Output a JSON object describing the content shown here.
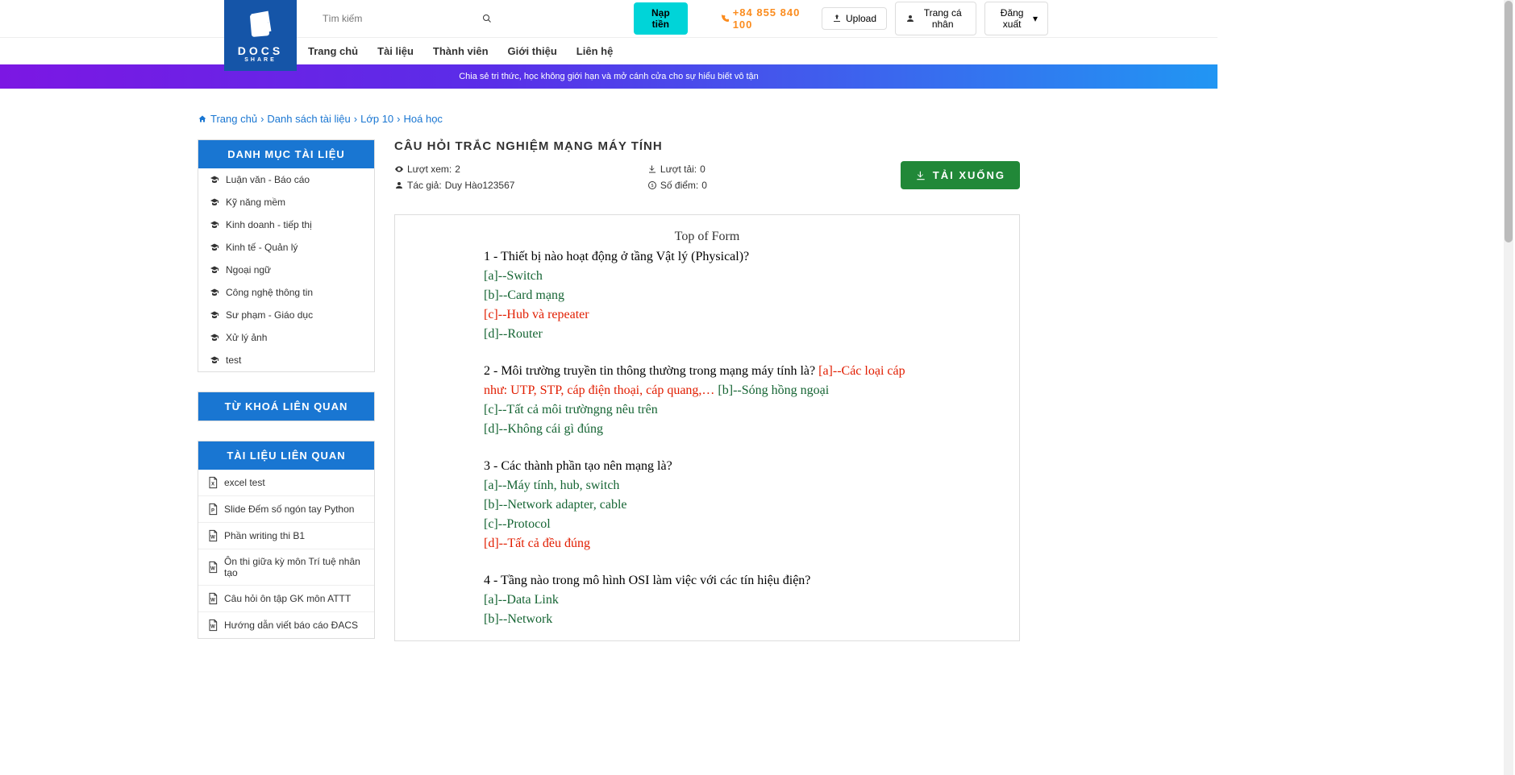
{
  "header": {
    "search_placeholder": "Tìm kiếm",
    "btn_nap": "Nạp tiền",
    "phone": "+84 855 840 100",
    "btn_upload": "Upload",
    "btn_profile": "Trang cá nhân",
    "btn_logout": "Đăng xuất"
  },
  "logo": {
    "main": "DOCS",
    "sub": "SHARE"
  },
  "nav": {
    "home": "Trang chủ",
    "docs": "Tài liệu",
    "members": "Thành viên",
    "about": "Giới thiệu",
    "contact": "Liên hệ"
  },
  "banner": "Chia sẻ tri thức, học không giới hạn và mở cánh cửa cho sự hiểu biết vô tận",
  "breadcrumb": {
    "home": "Trang chủ",
    "list": "Danh sách tài liệu",
    "grade": "Lớp 10",
    "subject": "Hoá học"
  },
  "sidebar": {
    "cat_head": "DANH MỤC TÀI LIỆU",
    "cats": [
      "Luận văn - Báo cáo",
      "Kỹ năng mềm",
      "Kinh doanh - tiếp thị",
      "Kinh tế - Quản lý",
      "Ngoại ngữ",
      "Công nghệ thông tin",
      "Sư phạm - Giáo dục",
      "Xử lý ảnh",
      "test"
    ],
    "kw_head": "TỪ KHOÁ LIÊN QUAN",
    "rel_head": "TÀI LIỆU LIÊN QUAN",
    "related": [
      {
        "icon": "X",
        "label": "excel test"
      },
      {
        "icon": "P",
        "label": "Slide Đếm số ngón tay Python"
      },
      {
        "icon": "W",
        "label": "Phần writing thi B1"
      },
      {
        "icon": "W",
        "label": "Ôn thi giữa kỳ môn Trí tuệ nhân tạo"
      },
      {
        "icon": "W",
        "label": "Câu hỏi ôn tập GK môn ATTT"
      },
      {
        "icon": "W",
        "label": "Hướng dẫn viết báo cáo ĐACS"
      }
    ]
  },
  "doc": {
    "title": "CÂU HỎI TRẮC NGHIỆM MẠNG MÁY TÍNH",
    "views_label": "Lượt xem:",
    "views": "2",
    "author_label": "Tác giả:",
    "author": "Duy Hào123567",
    "downloads_label": "Lượt tải:",
    "downloads": "0",
    "score_label": "Số điểm:",
    "score": "0",
    "download_btn": "TẢI XUỐNG"
  },
  "viewer": {
    "top_form": "Top of Form",
    "q1": {
      "text": "1 - Thiết bị nào hoạt động ở tầng Vật lý (Physical)?",
      "a": "--Switch",
      "b": "--Card mạng",
      "c": "--Hub và repeater",
      "d": "--Router"
    },
    "q2": {
      "text": "2 - Môi trường truyền tin thông thường trong mạng máy tính là? ",
      "a": "--Các loại cáp như: UTP, STP, cáp điện thoại, cáp quang,…",
      "b": "--Sóng hồng ngoại",
      "c": "--Tất cả môi trườngng nêu trên",
      "d": "--Không cái gì đúng"
    },
    "q3": {
      "text": "3 - Các thành phần tạo nên mạng là?",
      "a": "--Máy tính, hub, switch",
      "b": "--Network adapter, cable",
      "c": "--Protocol",
      "d": "--Tất cả đều đúng"
    },
    "q4": {
      "text": "4 - Tầng nào trong mô hình OSI làm việc với các tín hiệu điện?",
      "a": "--Data Link",
      "b": "--Network"
    }
  }
}
